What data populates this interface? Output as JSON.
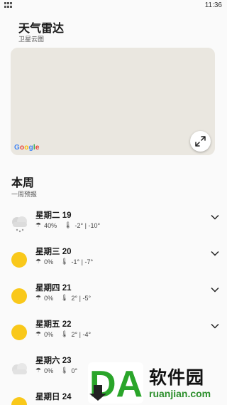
{
  "status_bar": {
    "time": "11:36"
  },
  "radar": {
    "title": "天气雷达",
    "subtitle": "卫星云图",
    "map_attribution": [
      "G",
      "o",
      "o",
      "g",
      "l",
      "e"
    ],
    "expand_icon": "expand-icon"
  },
  "week": {
    "title": "本周",
    "subtitle": "一周预报",
    "days": [
      {
        "name": "星期二 19",
        "precip": "40%",
        "temp": "-2° | -10°",
        "icon": "snow-cloud-icon"
      },
      {
        "name": "星期三 20",
        "precip": "0%",
        "temp": "-1° | -7°",
        "icon": "sun-icon"
      },
      {
        "name": "星期四 21",
        "precip": "0%",
        "temp": "2° | -5°",
        "icon": "sun-icon"
      },
      {
        "name": "星期五 22",
        "precip": "0%",
        "temp": "2° | -4°",
        "icon": "sun-icon"
      },
      {
        "name": "星期六 23",
        "precip": "0%",
        "temp": "0°",
        "icon": "cloud-icon"
      },
      {
        "name": "星期日 24",
        "precip": "",
        "temp": "",
        "icon": "sun-icon"
      }
    ]
  },
  "watermark": {
    "cn": "软件园",
    "en": "ruanjian.com",
    "logo": "DA"
  },
  "colors": {
    "sun": "#f9c81a",
    "cloud": "#d9d9d9",
    "map_bg": "#eae7e0",
    "watermark_green": "#2d8f2d"
  }
}
